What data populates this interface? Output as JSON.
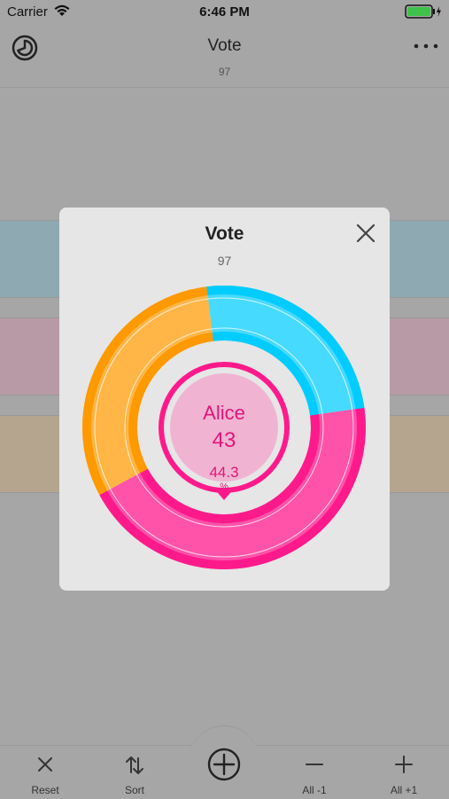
{
  "status_bar": {
    "carrier": "Carrier",
    "time": "6:46 PM"
  },
  "nav": {
    "title": "Vote",
    "subtitle": "97"
  },
  "modal": {
    "title": "Vote",
    "subtitle": "97"
  },
  "chart_data": {
    "type": "pie",
    "total": 97,
    "slices": [
      {
        "name": "Alice",
        "value": 43,
        "percent": "44.3",
        "color": "#ff1a8c"
      },
      {
        "name": "",
        "value": 30,
        "color": "#ff9900"
      },
      {
        "name": "",
        "value": 24,
        "color": "#00ccff"
      }
    ],
    "selected": {
      "name": "Alice",
      "value": "43",
      "percent": "44.3",
      "percent_sign": "%"
    }
  },
  "tab_bar": {
    "reset": "Reset",
    "sort": "Sort",
    "minus_all": "All -1",
    "plus_all": "All +1"
  },
  "icons": [
    "wifi-icon",
    "battery-icon",
    "pie-chart-icon",
    "more-icon",
    "close-icon",
    "reset-x-icon",
    "sort-icon",
    "add-circle-icon",
    "minus-icon",
    "plus-icon"
  ]
}
